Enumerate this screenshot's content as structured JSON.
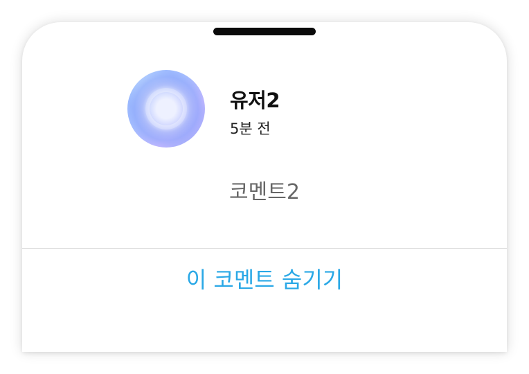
{
  "comment_sheet": {
    "user": {
      "name": "유저2",
      "time_ago": "5분 전",
      "avatar": "gradient-orb-avatar"
    },
    "comment": {
      "text": "코멘트2"
    },
    "action": {
      "hide_label": "이 코멘트 숨기기"
    }
  },
  "colors": {
    "accent": "#2aa8e6",
    "comment_text": "#666666",
    "divider": "#d9d9d9",
    "handle": "#0b0b0b"
  },
  "icons": {
    "drag_handle": "drag-handle-bar"
  }
}
